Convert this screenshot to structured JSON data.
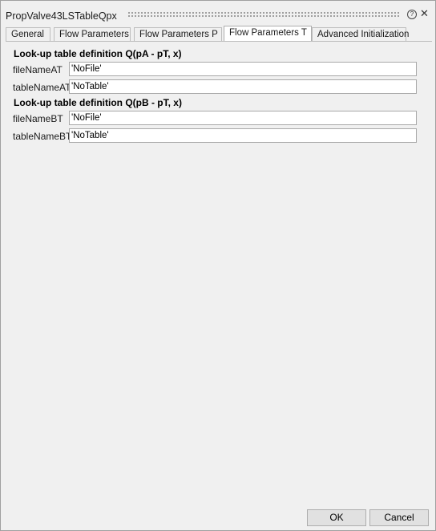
{
  "window": {
    "title": "PropValve43LSTableQpx",
    "help_glyph": "?",
    "close_glyph": "✕"
  },
  "tabs": [
    {
      "label": "General",
      "active": false
    },
    {
      "label": "Flow Parameters",
      "active": false
    },
    {
      "label": "Flow Parameters P",
      "active": false
    },
    {
      "label": "Flow Parameters T",
      "active": true
    },
    {
      "label": "Advanced Initialization",
      "active": false
    }
  ],
  "sections": [
    {
      "header": "Look-up table definition Q(pA - pT, x)",
      "fields": [
        {
          "label": "fileNameAT",
          "value": "'NoFile'"
        },
        {
          "label": "tableNameAT",
          "value": "'NoTable'"
        }
      ]
    },
    {
      "header": "Look-up table definition Q(pB - pT, x)",
      "fields": [
        {
          "label": "fileNameBT",
          "value": "'NoFile'"
        },
        {
          "label": "tableNameBT",
          "value": "'NoTable'"
        }
      ]
    }
  ],
  "buttons": {
    "ok_label": "OK",
    "cancel_label": "Cancel"
  }
}
